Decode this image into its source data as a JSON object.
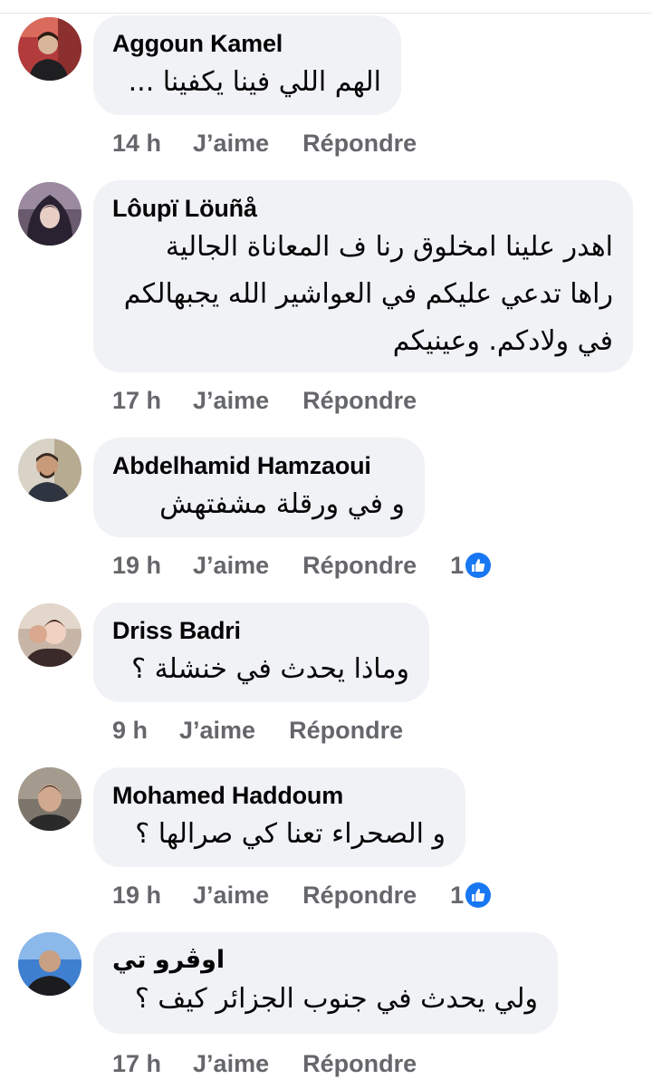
{
  "comments": [
    {
      "author": "Aggoun Kamel",
      "text": [
        "الهم اللي فينا يكفينا ..."
      ],
      "time": "14 h",
      "like_label": "J’aime",
      "reply_label": "Répondre",
      "reactions": null
    },
    {
      "author": "Lôupï Löuñå",
      "text": [
        "اهدر علينا امخلوق رنا ف المعاناة الجالية",
        "راها تدعي عليكم في العواشير الله يجبهالكم",
        "في ولادكم. وعينيكم"
      ],
      "time": "17 h",
      "like_label": "J’aime",
      "reply_label": "Répondre",
      "reactions": null
    },
    {
      "author": "Abdelhamid Hamzaoui",
      "text": [
        "و في ورقلة مشفتهش"
      ],
      "time": "19 h",
      "like_label": "J’aime",
      "reply_label": "Répondre",
      "reactions": "1"
    },
    {
      "author": "Driss Badri",
      "text": [
        "وماذا يحدث في خنشلة ؟"
      ],
      "time": "9 h",
      "like_label": "J’aime",
      "reply_label": "Répondre",
      "reactions": null
    },
    {
      "author": "Mohamed Haddoum",
      "text": [
        "و الصحراء تعنا كي صرالها ؟"
      ],
      "time": "19 h",
      "like_label": "J’aime",
      "reply_label": "Répondre",
      "reactions": "1"
    },
    {
      "author": "اوڤرو تي",
      "text": [
        "ولي يحدث في جنوب الجزائر كيف ؟"
      ],
      "time": "17 h",
      "like_label": "J’aime",
      "reply_label": "Répondre",
      "reactions": null
    }
  ],
  "icons": {
    "reaction": "like-icon"
  },
  "colors": {
    "bubble": "#f0f2f5",
    "action_text": "#65676b",
    "like_blue": "#1877f2"
  }
}
